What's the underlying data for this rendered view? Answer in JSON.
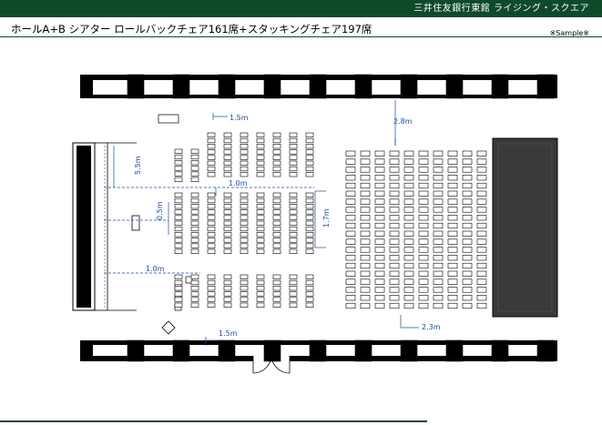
{
  "header": {
    "brand": "三井住友銀行東館 ライジング・スクエア",
    "title": "ホールA+B シアター ロールバックチェア161席+スタッキングチェア197席",
    "sample_note": "※Sample※"
  },
  "floor_plan": {
    "dimensions": [
      {
        "id": "d1",
        "label": "1.5m"
      },
      {
        "id": "d2",
        "label": "2.8m"
      },
      {
        "id": "d3",
        "label": "5.5m"
      },
      {
        "id": "d4",
        "label": "1.0m"
      },
      {
        "id": "d5",
        "label": "0.5m"
      },
      {
        "id": "d6",
        "label": "1.7m"
      },
      {
        "id": "d7",
        "label": "1.0m"
      },
      {
        "id": "d8",
        "label": "2.3m"
      },
      {
        "id": "d9",
        "label": "1.5m"
      }
    ],
    "colors": {
      "header_band": "#0d4a2a",
      "dimension": "#1b4d9a",
      "stage": "#3a3a3a",
      "wall": "#000000"
    }
  }
}
